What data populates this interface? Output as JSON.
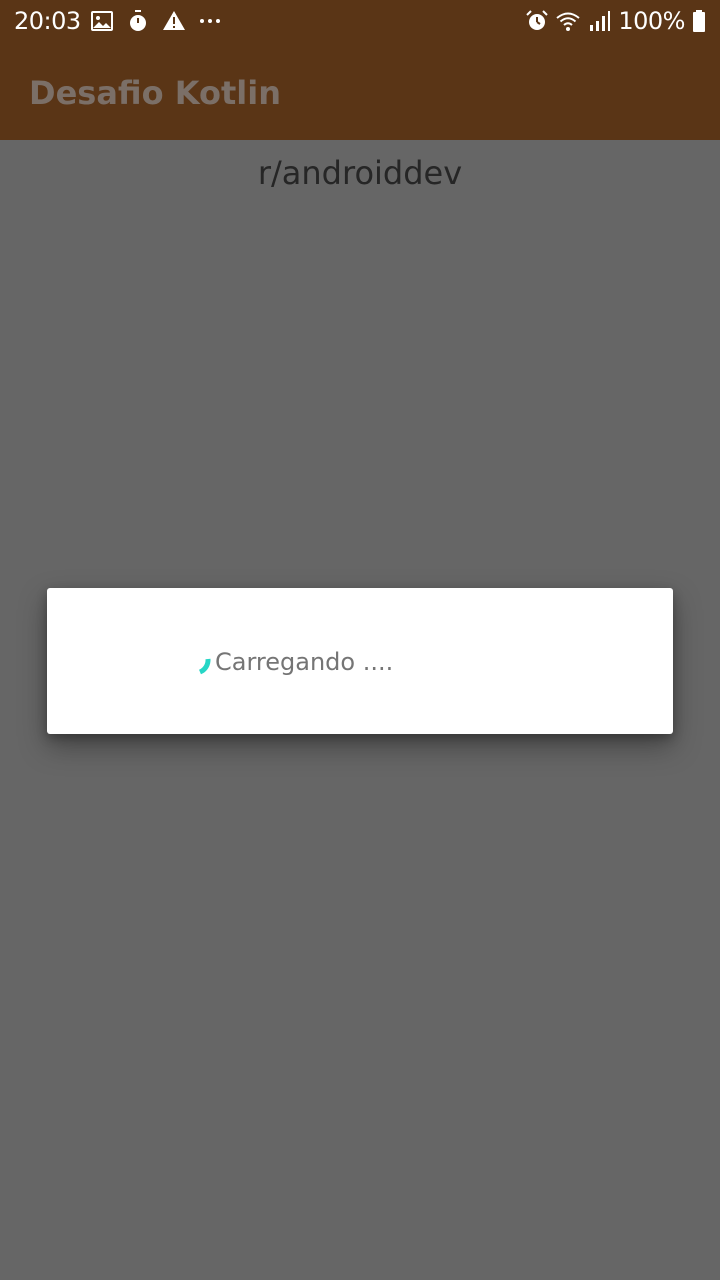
{
  "status_bar": {
    "time": "20:03",
    "left_icons": [
      "image-icon",
      "timer-icon",
      "warning-icon",
      "more-dots-icon"
    ],
    "right_icons": [
      "alarm-icon",
      "wifi-icon",
      "signal-icon",
      "battery-icon"
    ],
    "battery": "100%"
  },
  "app_bar": {
    "title": "Desafio Kotlin"
  },
  "main": {
    "subreddit": "r/androiddev"
  },
  "loading_dialog": {
    "message": "Carregando ...."
  },
  "colors": {
    "app_bar": "#5a3516",
    "scrim": "#666666",
    "dialog": "#ffffff",
    "spinner": "#26d6c6"
  }
}
